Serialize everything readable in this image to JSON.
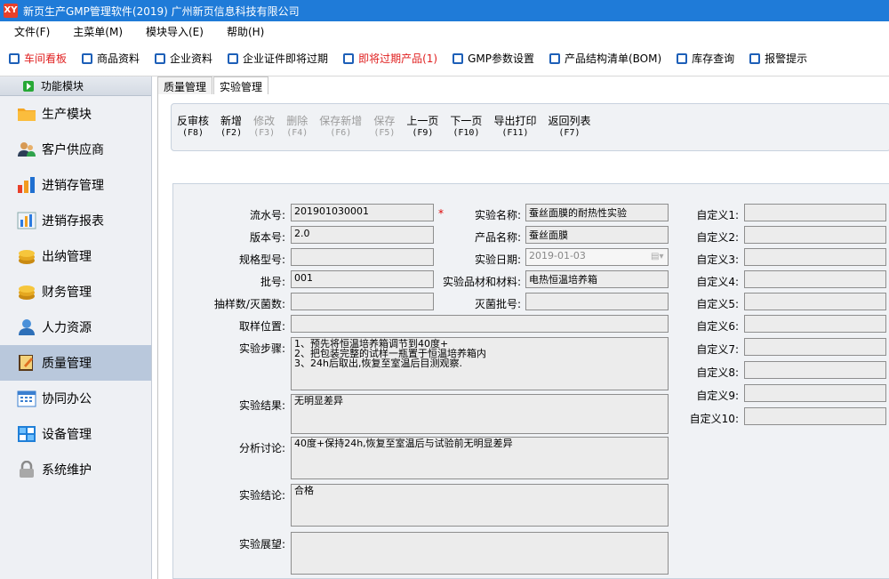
{
  "window": {
    "title": "新页生产GMP管理软件(2019) 广州新页信息科技有限公司",
    "app_icon": "XY"
  },
  "menu": [
    "文件(F)",
    "主菜单(M)",
    "模块导入(E)",
    "帮助(H)"
  ],
  "quickbar": [
    {
      "label": "车间看板",
      "red": true
    },
    {
      "label": "商品资料",
      "red": false
    },
    {
      "label": "企业资料",
      "red": false
    },
    {
      "label": "企业证件即将过期",
      "red": false
    },
    {
      "label": "即将过期产品(1)",
      "red": true
    },
    {
      "label": "GMP参数设置",
      "red": false
    },
    {
      "label": "产品结构清单(BOM)",
      "red": false
    },
    {
      "label": "库存查询",
      "red": false
    },
    {
      "label": "报警提示",
      "red": false
    }
  ],
  "sidebar": {
    "header": "功能模块",
    "items": [
      {
        "label": "生产模块",
        "icon": "folder-icon"
      },
      {
        "label": "客户供应商",
        "icon": "users-icon"
      },
      {
        "label": "进销存管理",
        "icon": "bar-chart-icon"
      },
      {
        "label": "进销存报表",
        "icon": "report-icon"
      },
      {
        "label": "出纳管理",
        "icon": "coins-icon"
      },
      {
        "label": "财务管理",
        "icon": "coins-icon"
      },
      {
        "label": "人力资源",
        "icon": "person-icon"
      },
      {
        "label": "质量管理",
        "icon": "book-icon"
      },
      {
        "label": "协同办公",
        "icon": "calendar-icon"
      },
      {
        "label": "设备管理",
        "icon": "windows-icon"
      },
      {
        "label": "系统维护",
        "icon": "lock-icon"
      }
    ]
  },
  "tabs": [
    "质量管理",
    "实验管理"
  ],
  "toolbar": [
    {
      "label": "反审核",
      "key": "(F8)",
      "disabled": false
    },
    {
      "label": "新增",
      "key": "(F2)",
      "disabled": false
    },
    {
      "label": "修改",
      "key": "(F3)",
      "disabled": true
    },
    {
      "label": "删除",
      "key": "(F4)",
      "disabled": true
    },
    {
      "label": "保存新增",
      "key": "(F6)",
      "disabled": true
    },
    {
      "label": "保存",
      "key": "(F5)",
      "disabled": true
    },
    {
      "label": "上一页",
      "key": "(F9)",
      "disabled": false
    },
    {
      "label": "下一页",
      "key": "(F10)",
      "disabled": false
    },
    {
      "label": "导出打印",
      "key": "(F11)",
      "disabled": false
    },
    {
      "label": "返回列表",
      "key": "(F7)",
      "disabled": false
    }
  ],
  "form": {
    "serial_label": "流水号:",
    "serial": "201901030001",
    "required_mark": "*",
    "exp_name_label": "实验名称:",
    "exp_name": "蚕丝面膜的耐热性实验",
    "version_label": "版本号:",
    "version": "2.0",
    "product_label": "产品名称:",
    "product": "蚕丝面膜",
    "spec_label": "规格型号:",
    "spec": "",
    "date_label": "实验日期:",
    "date": "2019-01-03",
    "batch_label": "批号:",
    "batch": "001",
    "material_label": "实验品材和材料:",
    "material": "电热恒温培养箱",
    "sample_label": "抽样数/灭菌数:",
    "sample": "",
    "sterile_label": "灭菌批号:",
    "sterile": "",
    "location_label": "取样位置:",
    "location": "",
    "steps_label": "实验步骤:",
    "steps": "1、预先将恒温培养箱调节到40度+\n2、把包装完整的试样一瓶置于恒温培养箱内\n3、24h后取出,恢复至室温后目测观察.",
    "result_label": "实验结果:",
    "result": "无明显差异",
    "analysis_label": "分析讨论:",
    "analysis": "40度+保持24h,恢复至室温后与试验前无明显差异",
    "conclusion_label": "实验结论:",
    "conclusion": "合格",
    "outlook_label": "实验展望:",
    "outlook": "",
    "custom": [
      {
        "label": "自定义1:",
        "value": ""
      },
      {
        "label": "自定义2:",
        "value": ""
      },
      {
        "label": "自定义3:",
        "value": ""
      },
      {
        "label": "自定义4:",
        "value": ""
      },
      {
        "label": "自定义5:",
        "value": ""
      },
      {
        "label": "自定义6:",
        "value": ""
      },
      {
        "label": "自定义7:",
        "value": ""
      },
      {
        "label": "自定义8:",
        "value": ""
      },
      {
        "label": "自定义9:",
        "value": ""
      },
      {
        "label": "自定义10:",
        "value": ""
      }
    ]
  }
}
